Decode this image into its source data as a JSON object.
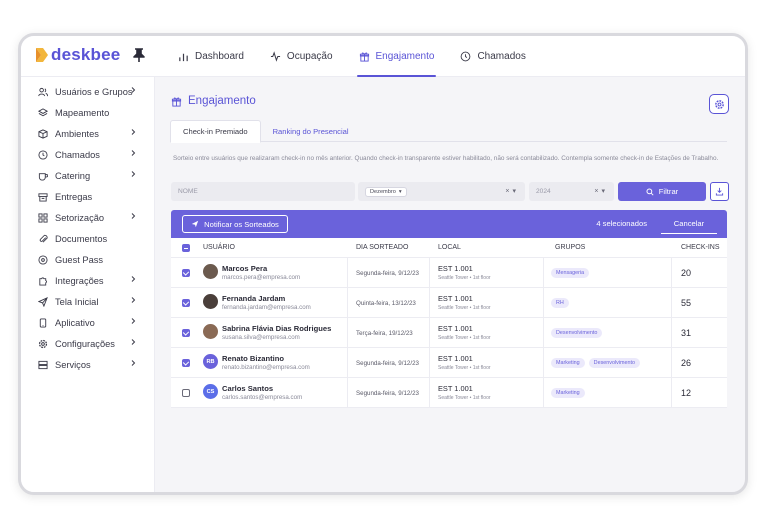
{
  "app": {
    "logo_text": "deskbee",
    "accent": "#5a54d6",
    "accent_bar": "#6a62db"
  },
  "topnav": [
    {
      "label": "Dashboard",
      "icon": "bar-chart-icon",
      "active": false
    },
    {
      "label": "Ocupação",
      "icon": "activity-icon",
      "active": false
    },
    {
      "label": "Engajamento",
      "icon": "gift-icon",
      "active": true
    },
    {
      "label": "Chamados",
      "icon": "clock-icon",
      "active": false
    }
  ],
  "sidebar": {
    "items": [
      {
        "label": "Usuários e Grupos",
        "icon": "users-icon",
        "chevron": true
      },
      {
        "label": "Mapeamento",
        "icon": "layers-icon",
        "chevron": false
      },
      {
        "label": "Ambientes",
        "icon": "cube-icon",
        "chevron": true
      },
      {
        "label": "Chamados",
        "icon": "clock-icon",
        "chevron": true
      },
      {
        "label": "Catering",
        "icon": "cup-icon",
        "chevron": true
      },
      {
        "label": "Entregas",
        "icon": "box-icon",
        "chevron": false
      },
      {
        "label": "Setorização",
        "icon": "grid-icon",
        "chevron": true
      },
      {
        "label": "Documentos",
        "icon": "paperclip-icon",
        "chevron": false
      },
      {
        "label": "Guest Pass",
        "icon": "location-icon",
        "chevron": false
      },
      {
        "label": "Integrações",
        "icon": "puzzle-icon",
        "chevron": true
      },
      {
        "label": "Tela Inicial",
        "icon": "send-icon",
        "chevron": true
      },
      {
        "label": "Aplicativo",
        "icon": "phone-icon",
        "chevron": true
      },
      {
        "label": "Configurações",
        "icon": "gear-icon",
        "chevron": true
      },
      {
        "label": "Serviços",
        "icon": "server-icon",
        "chevron": true
      }
    ]
  },
  "page": {
    "title": "Engajamento",
    "tabs": [
      {
        "label": "Check-in Premiado",
        "active": true
      },
      {
        "label": "Ranking do Presencial",
        "active": false
      }
    ],
    "description": "Sorteio entre usuários que realizaram check-in no mês anterior. Quando check-in transparente estiver habilitado, não será contabilizado. Contempla somente check-in de Estações de Trabalho."
  },
  "filters": {
    "name_placeholder": "NOME",
    "month_value": "Dezembro",
    "year_value": "2024",
    "clear_glyph": "×",
    "dropdown_glyph": "▾",
    "filter_label": "Filtrar"
  },
  "actionbar": {
    "notify_label": "Notificar os Sorteados",
    "selected_count": "4 selecionados",
    "cancel_label": "Cancelar"
  },
  "table": {
    "headers": [
      "USUÁRIO",
      "DIA SORTEADO",
      "LOCAL",
      "GRUPOS",
      "CHECK-INS"
    ],
    "rows": [
      {
        "checked": true,
        "name": "Marcos Pera",
        "email": "marcos.pera@empresa.com",
        "avatar_initials": "",
        "avatar_color": "#6b5a4e",
        "date": "Segunda-feira, 9/12/23",
        "local": "EST 1.001",
        "local_sub": "Seattle Tower • 1st floor",
        "groups": [
          "Mensageria"
        ],
        "checkins": "20"
      },
      {
        "checked": true,
        "name": "Fernanda Jardam",
        "email": "fernanda.jardam@empresa.com",
        "avatar_initials": "",
        "avatar_color": "#4a3f3a",
        "date": "Quinta-feira, 13/12/23",
        "local": "EST 1.001",
        "local_sub": "Seattle Tower • 1st floor",
        "groups": [
          "RH"
        ],
        "checkins": "55"
      },
      {
        "checked": true,
        "name": "Sabrina Flávia Dias Rodrigues",
        "email": "susana.silva@empresa.com",
        "avatar_initials": "",
        "avatar_color": "#8a6a55",
        "date": "Terça-feira, 19/12/23",
        "local": "EST 1.001",
        "local_sub": "Seattle Tower • 1st floor",
        "groups": [
          "Desenvolvimento"
        ],
        "checkins": "31"
      },
      {
        "checked": true,
        "name": "Renato Bizantino",
        "email": "renato.bizantino@empresa.com",
        "avatar_initials": "RB",
        "avatar_color": "#6a62db",
        "date": "Segunda-feira, 9/12/23",
        "local": "EST 1.001",
        "local_sub": "Seattle Tower • 1st floor",
        "groups": [
          "Marketing",
          "Desenvolvimento"
        ],
        "checkins": "26"
      },
      {
        "checked": false,
        "name": "Carlos Santos",
        "email": "carlos.santos@empresa.com",
        "avatar_initials": "CS",
        "avatar_color": "#5b6ee8",
        "date": "Segunda-feira, 9/12/23",
        "local": "EST 1.001",
        "local_sub": "Seattle Tower • 1st floor",
        "groups": [
          "Marketing"
        ],
        "checkins": "12"
      }
    ]
  }
}
